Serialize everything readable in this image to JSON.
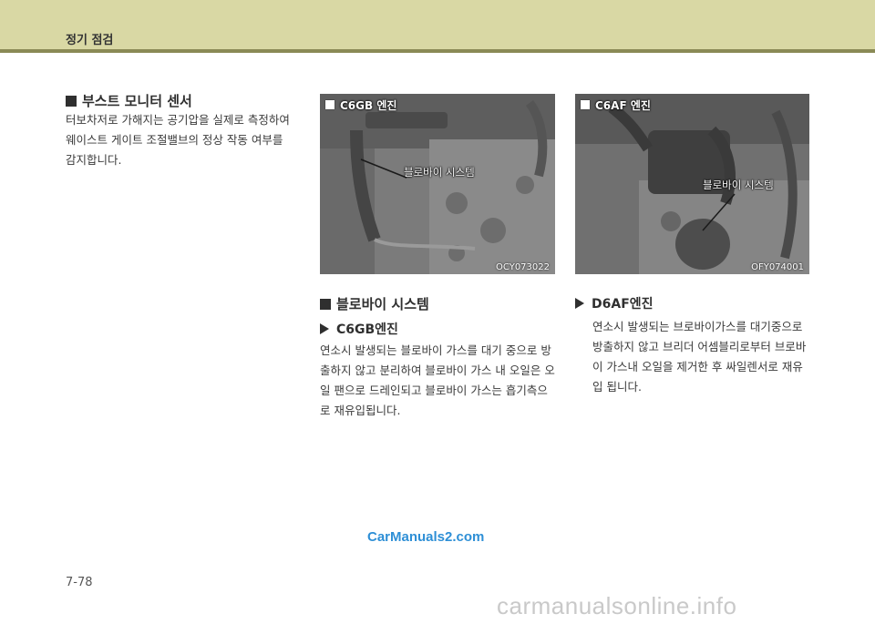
{
  "header": {
    "title": "정기 점검"
  },
  "boost_sensor": {
    "title": "부스트 모니터 센서",
    "body": [
      "터보차저로 가해지는 공기압을 실제로 측정하여",
      "웨이스트 게이트 조절밸브의 정상 작동 여부를",
      "감지합니다."
    ]
  },
  "photo_c6gb": {
    "tag": "C6GB 엔진",
    "callout": "블로바이 시스템",
    "code": "OCY073022"
  },
  "photo_c6af": {
    "tag": "C6AF 엔진",
    "callout": "블로바이 시스템",
    "code": "OFY074001"
  },
  "blowby": {
    "title": "블로바이 시스템",
    "c6gb": {
      "heading": "C6GB엔진",
      "body": [
        "연소시 발생되는 블로바이 가스를 대기 중으로 방",
        "출하지 않고 분리하여 블로바이 가스 내 오일은 오",
        "일 팬으로 드레인되고 블로바이 가스는 흡기측으",
        "로 재유입됩니다."
      ]
    },
    "d6af": {
      "heading": "D6AF엔진",
      "body": [
        "연소시 발생되는 브로바이가스를 대기중으로",
        "방출하지 않고 브리더 어셈블리로부터 브로바",
        "이 가스내 오일을 제거한 후 싸일렌서로 재유",
        "입 됩니다."
      ]
    }
  },
  "watermark": "CarManuals2.com",
  "page_number": "7-78",
  "footer_watermark": "carmanualsonline.info"
}
